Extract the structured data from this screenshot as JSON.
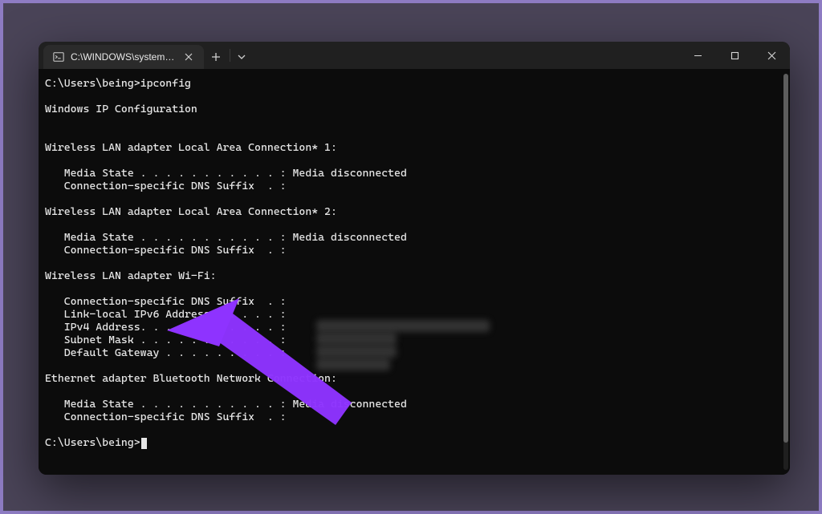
{
  "titlebar": {
    "tab_title": "C:\\WINDOWS\\system32\\cmd.",
    "cmd_icon": "cmd-icon",
    "close_tab_icon": "close-icon",
    "new_tab_icon": "plus-icon",
    "dropdown_icon": "chevron-down-icon",
    "minimize_icon": "minimize-icon",
    "maximize_icon": "maximize-icon",
    "window_close_icon": "close-icon"
  },
  "terminal": {
    "prompt_line": "C:\\Users\\being>ipconfig",
    "header": "Windows IP Configuration",
    "sections": [
      {
        "title": "Wireless LAN adapter Local Area Connection* 1:",
        "lines": [
          "   Media State . . . . . . . . . . . : Media disconnected",
          "   Connection-specific DNS Suffix  . :"
        ]
      },
      {
        "title": "Wireless LAN adapter Local Area Connection* 2:",
        "lines": [
          "   Media State . . . . . . . . . . . : Media disconnected",
          "   Connection-specific DNS Suffix  . :"
        ]
      },
      {
        "title": "Wireless LAN adapter Wi-Fi:",
        "lines": [
          "   Connection-specific DNS Suffix  . :",
          "   Link-local IPv6 Address . . . . . : ",
          "   IPv4 Address. . . . . . . . . . . : ",
          "   Subnet Mask . . . . . . . . . . . : ",
          "   Default Gateway . . . . . . . . . : "
        ]
      },
      {
        "title": "Ethernet adapter Bluetooth Network Connection:",
        "lines": [
          "   Media State . . . . . . . . . . . : Media disconnected",
          "   Connection-specific DNS Suffix  . :"
        ]
      }
    ],
    "final_prompt": "C:\\Users\\being>"
  },
  "annotation": {
    "arrow_color": "#8e33ff"
  }
}
